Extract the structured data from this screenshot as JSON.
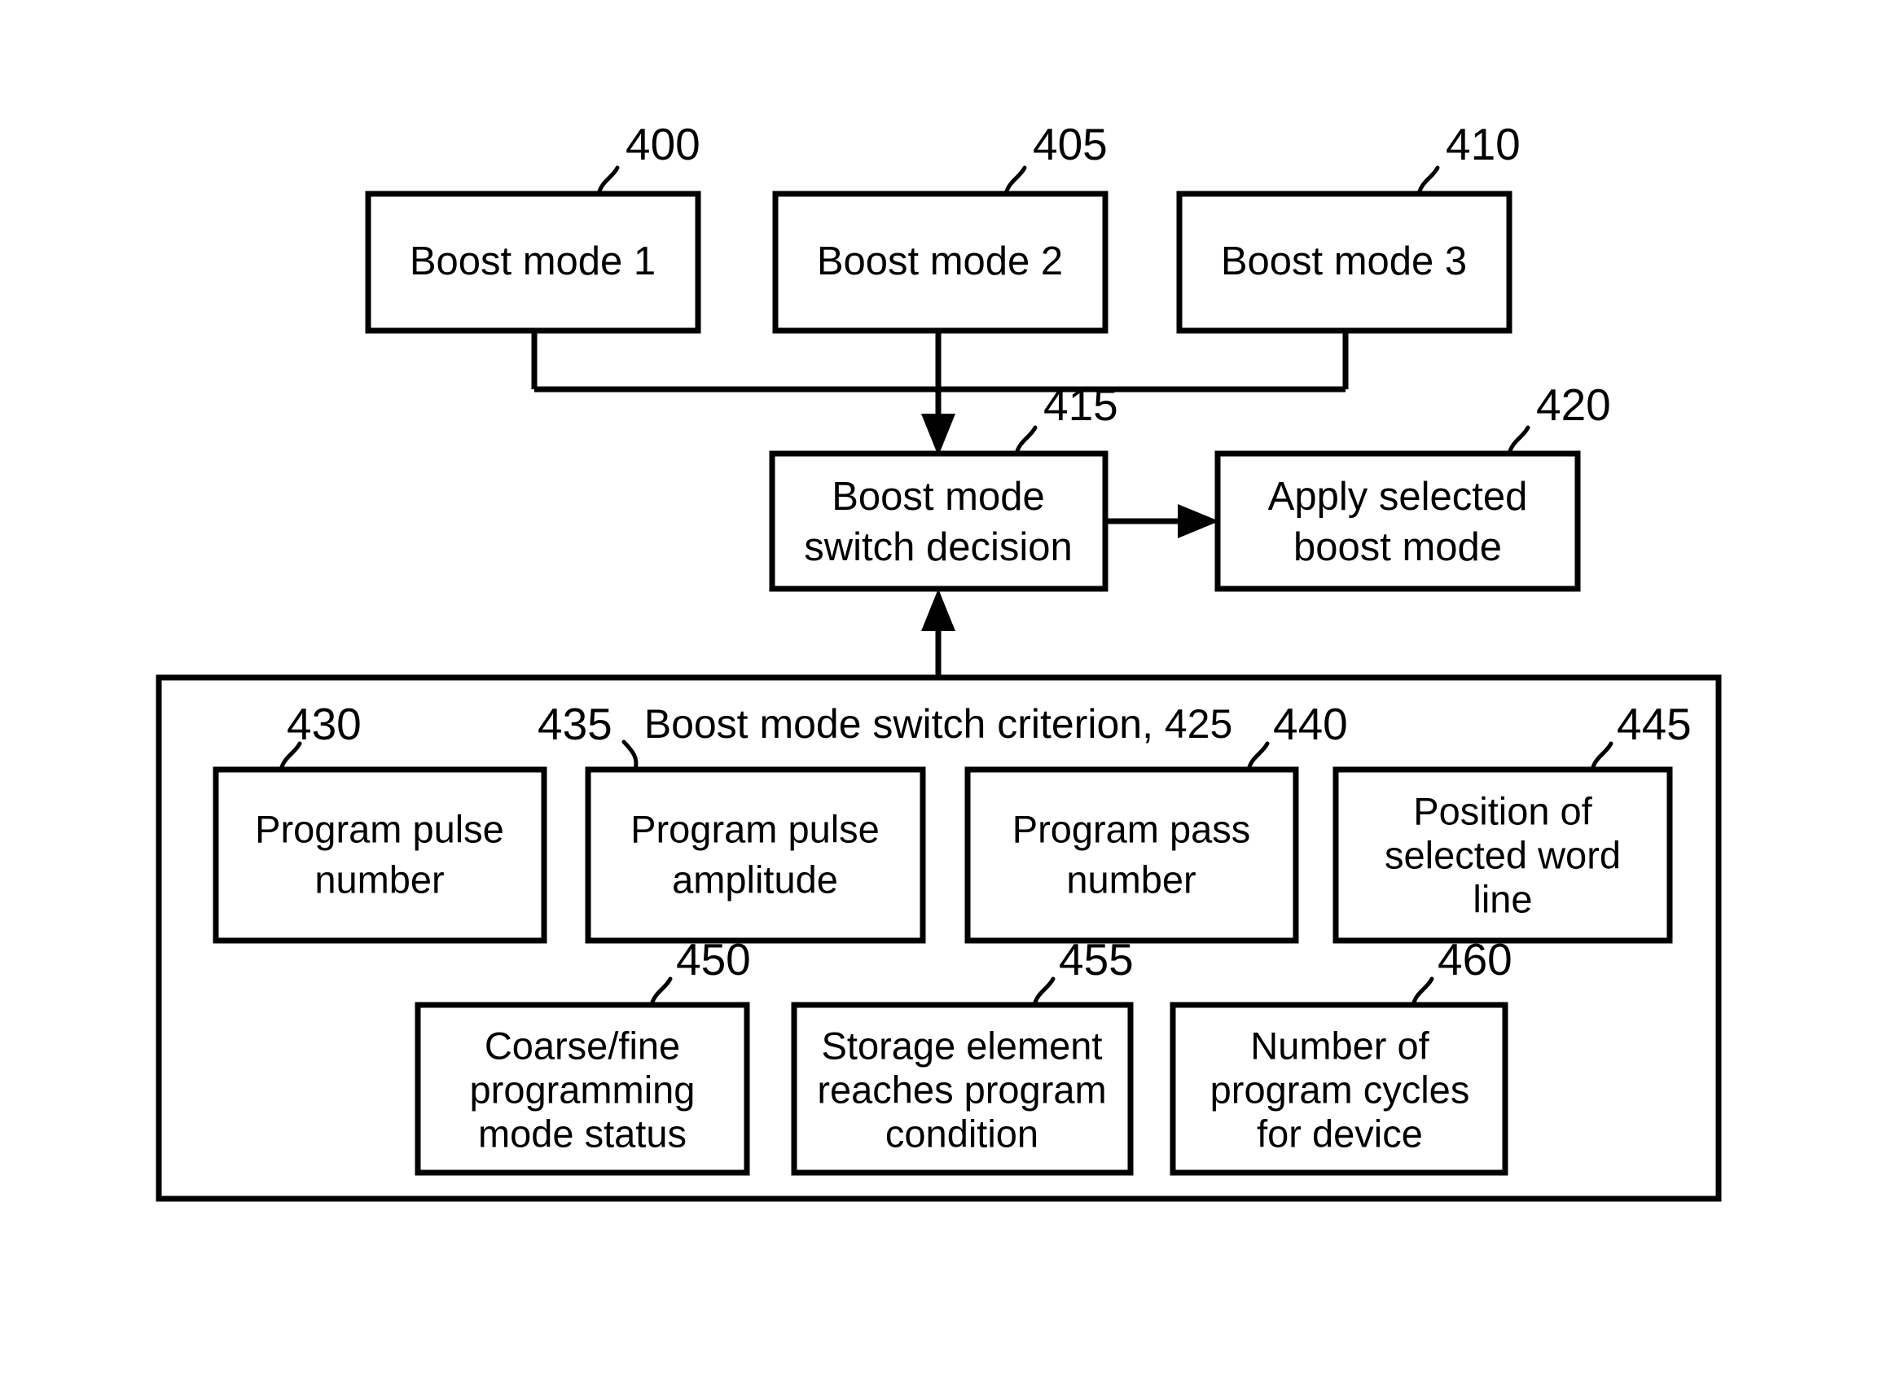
{
  "figure": {
    "type": "patent-flow-diagram",
    "background_color": "#ffffff",
    "line_color": "#000000"
  },
  "boost_modes": [
    {
      "ref": "400",
      "label": "Boost mode 1"
    },
    {
      "ref": "405",
      "label": "Boost mode 2"
    },
    {
      "ref": "410",
      "label": "Boost mode 3"
    }
  ],
  "decision": {
    "ref": "415",
    "line1": "Boost mode",
    "line2": "switch decision"
  },
  "apply": {
    "ref": "420",
    "line1": "Apply selected",
    "line2": "boost mode"
  },
  "criterion": {
    "title": "Boost mode switch criterion, 425",
    "ref": "425",
    "row1": [
      {
        "ref": "430",
        "line1": "Program pulse",
        "line2": "number",
        "line3": ""
      },
      {
        "ref": "435",
        "line1": "Program pulse",
        "line2": "amplitude",
        "line3": ""
      },
      {
        "ref": "440",
        "line1": "Program pass",
        "line2": "number",
        "line3": ""
      },
      {
        "ref": "445",
        "line1": "Position of",
        "line2": "selected word",
        "line3": "line"
      }
    ],
    "row2": [
      {
        "ref": "450",
        "line1": "Coarse/fine",
        "line2": "programming",
        "line3": "mode status"
      },
      {
        "ref": "455",
        "line1": "Storage element",
        "line2": "reaches program",
        "line3": "condition"
      },
      {
        "ref": "460",
        "line1": "Number of",
        "line2": "program cycles",
        "line3": "for device"
      }
    ]
  }
}
